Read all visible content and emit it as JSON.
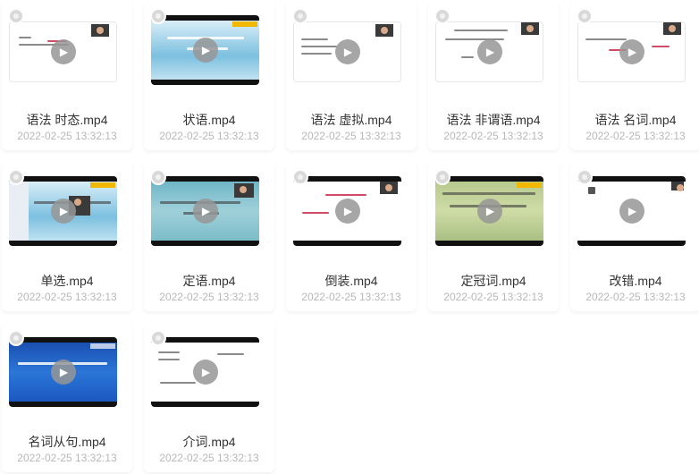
{
  "files": [
    {
      "name": "语法 时态.mp4",
      "date": "2022-02-25 13:32:13"
    },
    {
      "name": "状语.mp4",
      "date": "2022-02-25 13:32:13"
    },
    {
      "name": "语法 虚拟.mp4",
      "date": "2022-02-25 13:32:13"
    },
    {
      "name": "语法 非谓语.mp4",
      "date": "2022-02-25 13:32:13"
    },
    {
      "name": "语法 名词.mp4",
      "date": "2022-02-25 13:32:13"
    },
    {
      "name": "单选.mp4",
      "date": "2022-02-25 13:32:13"
    },
    {
      "name": "定语.mp4",
      "date": "2022-02-25 13:32:13"
    },
    {
      "name": "倒装.mp4",
      "date": "2022-02-25 13:32:13"
    },
    {
      "name": "定冠词.mp4",
      "date": "2022-02-25 13:32:13"
    },
    {
      "name": "改错.mp4",
      "date": "2022-02-25 13:32:13"
    },
    {
      "name": "名词从句.mp4",
      "date": "2022-02-25 13:32:13"
    },
    {
      "name": "介词.mp4",
      "date": "2022-02-25 13:32:13"
    }
  ],
  "icons": {
    "play": "play-icon",
    "select": "select-circle-icon"
  },
  "colors": {
    "filename": "#333333",
    "date": "#b8b8b8",
    "play_overlay": "#969696"
  }
}
